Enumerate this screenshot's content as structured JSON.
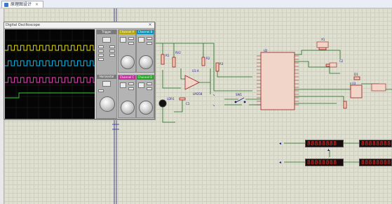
{
  "tab": {
    "title": "原理图设计",
    "close": "×"
  },
  "oscilloscope": {
    "title": "Digital Oscilloscope",
    "close": "×",
    "trigger_label": "Trigger",
    "channels": [
      {
        "name": "Channel A",
        "color": "#f2e600"
      },
      {
        "name": "Channel B",
        "color": "#00c8ff"
      },
      {
        "name": "Channel C",
        "color": "#ff3ec8"
      },
      {
        "name": "Channel D",
        "color": "#35d435"
      }
    ],
    "horizontal_label": "Horizontal"
  },
  "components": {
    "rv2": "RV2",
    "u1a": "U1:A",
    "lm358": "LM358",
    "u2": "U2",
    "ls1": "LDR1",
    "sw1": "SW1",
    "r1": "R1",
    "r2": "R2",
    "r3": "R3",
    "r4": "R4",
    "c1": "C1",
    "c2": "C2",
    "d1": "D1",
    "q1": "Q1",
    "u3": "U3",
    "x1": "X1"
  },
  "displays": [
    {
      "value": "88888888"
    },
    {
      "value": "88888888"
    },
    {
      "value": "88888888"
    },
    {
      "value": "88888888"
    }
  ],
  "colors": {
    "wire": "#1b6b1b",
    "component": "#9b1b1b",
    "chip_fill": "#f1d5c8"
  }
}
